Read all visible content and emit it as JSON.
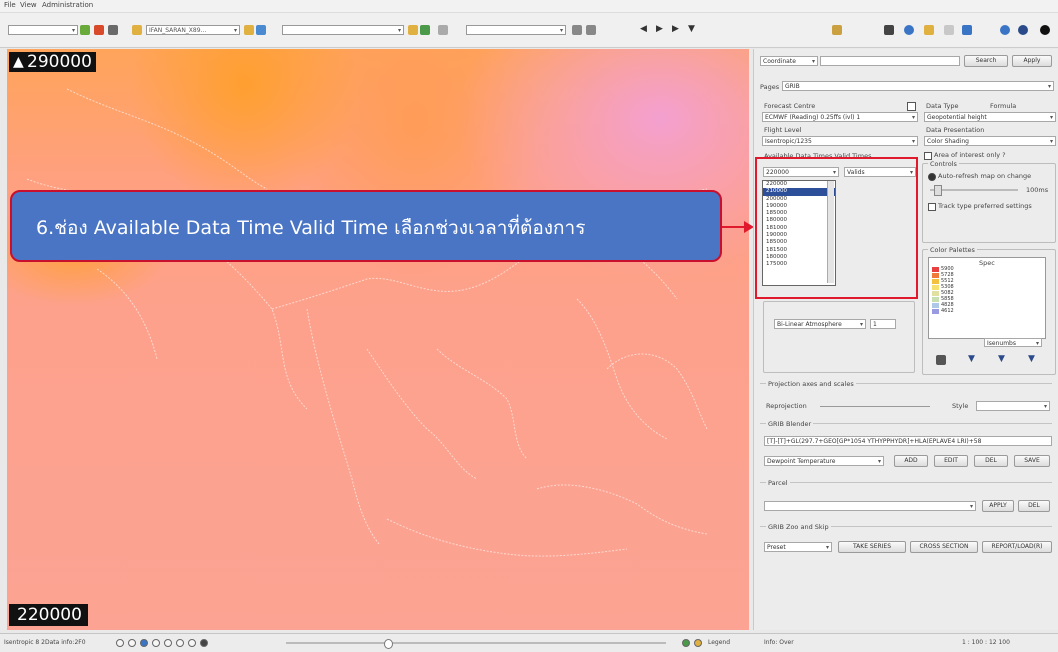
{
  "menubar": {
    "items": [
      "File",
      "View",
      "Administration"
    ]
  },
  "toolbar": {
    "combo1": "",
    "combo2": "IFAN_SARAN_X89...",
    "combo3": "",
    "combo4": ""
  },
  "map": {
    "top_label": "290000",
    "bottom_label": "220000",
    "north_icon": "north-arrow-icon"
  },
  "callout": {
    "text": "6.ช่อง Available Data Time Valid Time เลือกช่วงเวลาที่ต้องการ"
  },
  "panel": {
    "coord_mode": "Coordinate",
    "search_label": "Search",
    "apply_label": "Apply",
    "pages_label": "Pages",
    "pages_value": "GRIB",
    "forecast_centre_label": "Forecast Centre",
    "forecast_centre_value": "ECMWF (Reading) 0.25ffs (ivl) 1",
    "data_type_label": "Data Type",
    "formula_label": "Formula",
    "data_type_value": "Geopotential height",
    "flight_level_label": "Flight Level",
    "flight_level_value": "Isentropic/1235",
    "data_presentation_label": "Data Presentation",
    "data_presentation_value": "Color Shading",
    "area_of_interest_label": "Area of interest only ?",
    "available_times_label": "Available Data Times   Valid Times",
    "time_selected": "220000",
    "valid_time_value": "Valids",
    "times": [
      "220000",
      "210000",
      "200000",
      "190000",
      "185000",
      "180000",
      "181000",
      "190000",
      "185000",
      "181500",
      "180000",
      "175000"
    ],
    "controls_label": "Controls",
    "auto_refresh_label": "Auto-refresh map on change",
    "zoom_value": "100ms",
    "track_label": "Track type preferred settings",
    "color_palettes_label": "Color Palettes",
    "spectrum_label": "Spec",
    "palette_values": [
      "5900",
      "5728",
      "5512",
      "5308",
      "5082",
      "5858",
      "4828",
      "4612"
    ],
    "palette_colors": [
      "#e84040",
      "#f07a3a",
      "#f4c040",
      "#f6e070",
      "#e0e0a0",
      "#c8e0b0",
      "#b0c8e8",
      "#9a9ae0"
    ],
    "palette_select": "Isenumbs",
    "atmosphere_value": "Bi-Linear Atmosphere",
    "atmosphere_num": "1",
    "projection_label": "Projection axes and scales",
    "reprojection_label": "Reprojection",
    "style_label": "Style",
    "grib_blender_label": "GRIB Blender",
    "grib_blender_expr": "[T]-[T]+GL(297.7+GEO[GP*1054 YTHYPPHYDR]+HLA(EPLAVE4 LRI)+58",
    "blender_select": "Dewpoint Temperature",
    "btn_add": "ADD",
    "btn_edit": "EDIT",
    "btn_del": "DEL",
    "btn_save": "SAVE",
    "parcel_label": "Parcel",
    "parcel_value": "",
    "btn_apply": "APPLY",
    "btn_del2": "DEL",
    "grib_zoo_label": "GRIB Zoo and Skip",
    "preset_value": "Preset",
    "btn_take_series": "TAKE SERIES",
    "btn_cross_section": "CROSS SECTION",
    "btn_report_loads": "REPORT/LOAD(R)"
  },
  "statusbar": {
    "left_text": "Isentropic 8 2Data info:2F0",
    "legend_label": "Legend",
    "mid_text": "Info: Over",
    "right_text": "1 : 100 : 12 100"
  }
}
